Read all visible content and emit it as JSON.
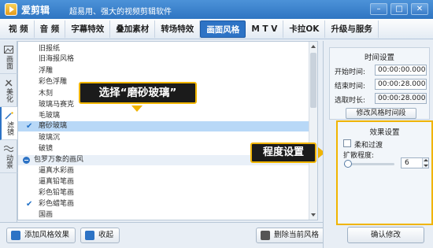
{
  "app": {
    "name": "爱剪辑",
    "slogan": "超易用、强大的视频剪辑软件"
  },
  "window_controls": [
    "–",
    "□",
    "✕"
  ],
  "menu": [
    {
      "label": "视  频",
      "active": false
    },
    {
      "label": "音  频",
      "active": false
    },
    {
      "label": "字幕特效",
      "active": false
    },
    {
      "label": "叠加素材",
      "active": false
    },
    {
      "label": "转场特效",
      "active": false
    },
    {
      "label": "画面风格",
      "active": true
    },
    {
      "label": "M T V",
      "active": false
    },
    {
      "label": "卡拉OK",
      "active": false
    },
    {
      "label": "升级与服务",
      "active": false
    }
  ],
  "side_tabs": [
    {
      "label": "画面",
      "icon": "frame-icon",
      "active": false
    },
    {
      "label": "美化",
      "icon": "tools-icon",
      "active": false
    },
    {
      "label": "滤镜",
      "icon": "wand-icon",
      "active": true
    },
    {
      "label": "动景",
      "icon": "waves-icon",
      "active": false
    }
  ],
  "filter_list": [
    {
      "label": "旧报纸",
      "checked": false,
      "selected": false
    },
    {
      "label": "旧海报风格",
      "checked": false,
      "selected": false
    },
    {
      "label": "浮雕",
      "checked": false,
      "selected": false
    },
    {
      "label": "彩色浮雕",
      "checked": false,
      "selected": false
    },
    {
      "label": "木刻",
      "checked": false,
      "selected": false
    },
    {
      "label": "玻璃马赛克",
      "checked": false,
      "selected": false
    },
    {
      "label": "毛玻璃",
      "checked": false,
      "selected": false
    },
    {
      "label": "磨砂玻璃",
      "checked": true,
      "selected": true
    },
    {
      "label": "玻璃沉",
      "checked": false,
      "selected": false
    },
    {
      "label": "破镜",
      "checked": false,
      "selected": false
    }
  ],
  "group": {
    "label": "包罗万象的画风",
    "items": [
      {
        "label": "逼真水彩画",
        "checked": false
      },
      {
        "label": "逼真铅笔画",
        "checked": false
      },
      {
        "label": "彩色铅笔画",
        "checked": false
      },
      {
        "label": "彩色蜡笔画",
        "checked": true
      },
      {
        "label": "国画",
        "checked": false
      }
    ]
  },
  "callouts": {
    "select": "选择“磨砂玻璃”",
    "degree": "程度设置"
  },
  "toolbar": {
    "add": "添加风格效果",
    "collapse": "收起",
    "delete": "删除当前风格"
  },
  "time_settings": {
    "title": "时间设置",
    "start_label": "开始时间:",
    "start_value": "00:00:00.000",
    "end_label": "结束时间:",
    "end_value": "00:00:28.000",
    "duration_label": "选取时长:",
    "duration_value": "00:00:28.000",
    "modify_button": "修改风格时间段"
  },
  "effect_settings": {
    "title": "效果设置",
    "soft_label": "柔和过渡",
    "soft_checked": false,
    "spread_label": "扩散程度:",
    "spread_value": "6",
    "spread_fraction": 0.08
  },
  "confirm_button": "确认修改",
  "colors": {
    "accent": "#2d73c5",
    "highlight": "#f0b400",
    "selected_row": "#b8d8f7"
  }
}
